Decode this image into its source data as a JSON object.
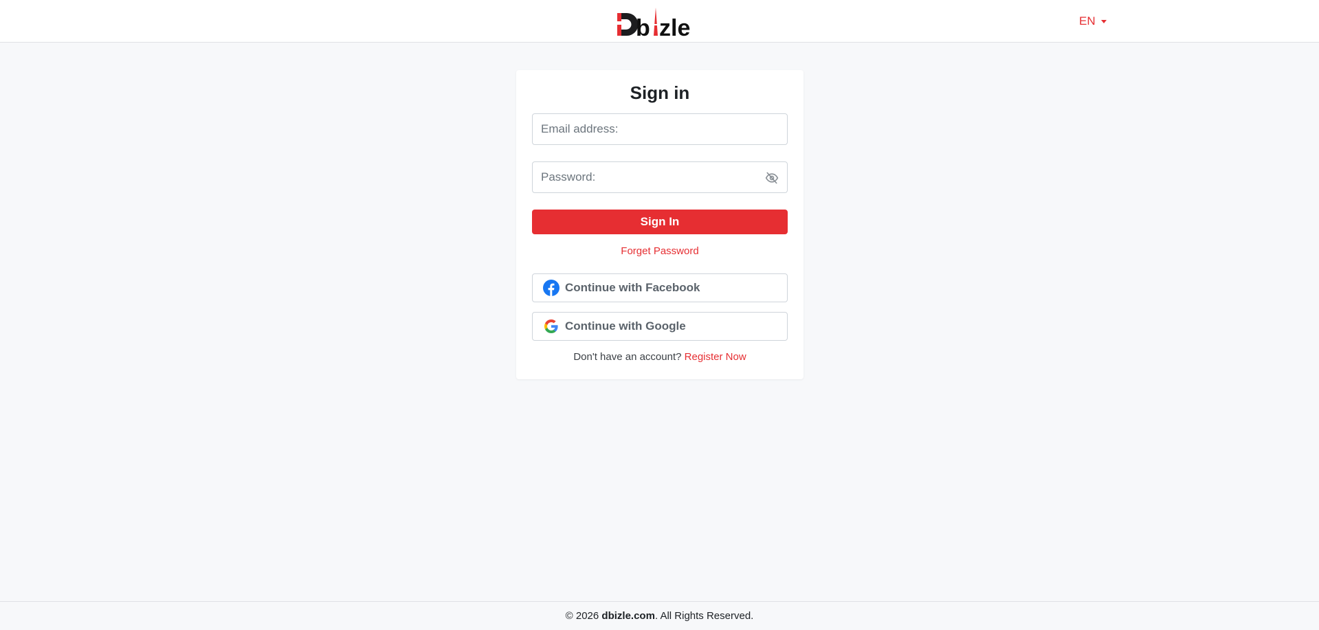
{
  "header": {
    "logo_text": "Dbizle",
    "language": "EN"
  },
  "signin": {
    "title": "Sign in",
    "email_placeholder": "Email address:",
    "password_placeholder": "Password:",
    "submit_label": "Sign In",
    "forget_label": "Forget Password",
    "facebook_label": "Continue with Facebook",
    "google_label": "Continue with Google",
    "no_account_text": "Don't have an account?",
    "register_label": "Register Now"
  },
  "footer": {
    "copyright_prefix": "© 2026",
    "site": "dbizle.com",
    "rights": ". All Rights Reserved."
  },
  "icons": {
    "password_toggle": "eye-slash-icon",
    "facebook": "facebook-icon",
    "google": "google-icon",
    "language_caret": "caret-down-icon"
  },
  "colors": {
    "brand_red": "#e62e32",
    "page_bg": "#f7f8fa",
    "facebook_blue": "#1877f2"
  }
}
